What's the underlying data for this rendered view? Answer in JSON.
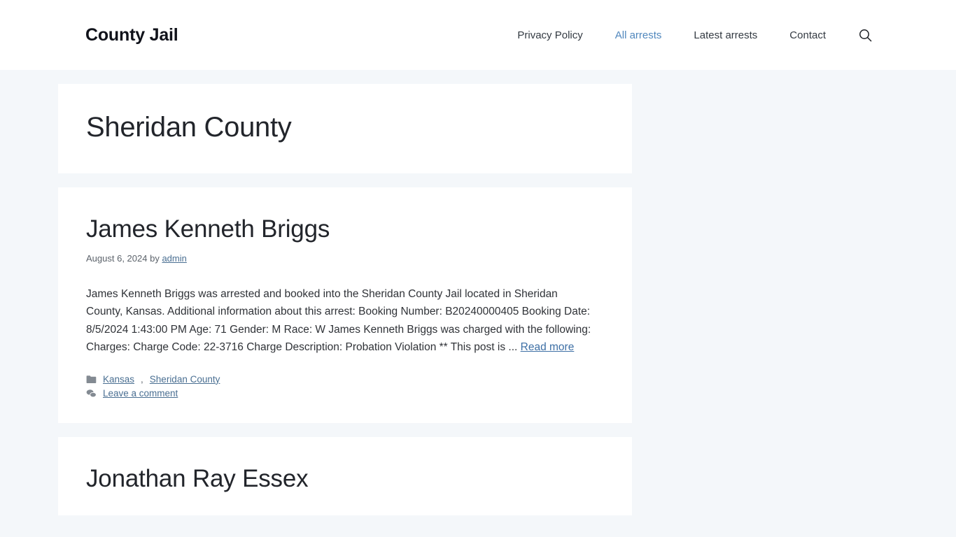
{
  "header": {
    "site_title": "County Jail",
    "nav": [
      {
        "label": "Privacy Policy",
        "current": false
      },
      {
        "label": "All arrests",
        "current": true
      },
      {
        "label": "Latest arrests",
        "current": false
      },
      {
        "label": "Contact",
        "current": false
      }
    ],
    "search_icon": "search-icon",
    "accent_color": "#5087bd"
  },
  "page": {
    "title": "Sheridan County",
    "background_color": "#f4f7fa",
    "card_color": "#ffffff"
  },
  "posts": [
    {
      "title": "James Kenneth Briggs",
      "date": "August 6, 2024",
      "by_label": "by",
      "author": "admin",
      "excerpt": "James Kenneth Briggs was arrested and booked into the Sheridan County Jail located in Sheridan County, Kansas. Additional information about this arrest: Booking Number: B20240000405 Booking Date: 8/5/2024 1:43:00 PM Age: 71 Gender: M Race: W James Kenneth Briggs was charged with the following: Charges: Charge Code: 22-3716 Charge Description: Probation Violation ** This post is ... ",
      "read_more": "Read more",
      "categories_icon": "folder-icon",
      "categories": [
        "Kansas",
        "Sheridan County"
      ],
      "comments_icon": "comments-icon",
      "comments_label": "Leave a comment"
    },
    {
      "title": "Jonathan Ray Essex"
    }
  ]
}
